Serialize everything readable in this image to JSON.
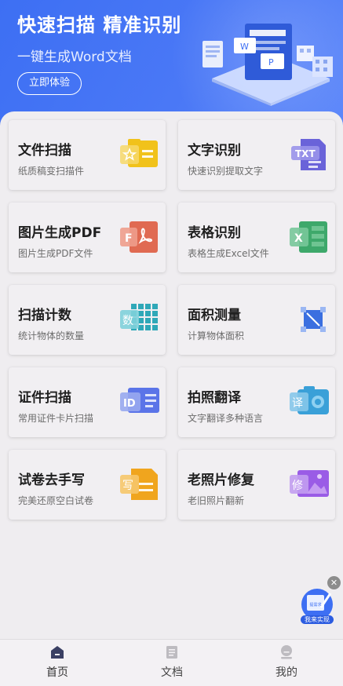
{
  "banner": {
    "title": "快速扫描 精准识别",
    "subtitle": "一键生成Word文档",
    "cta_label": "立即体验"
  },
  "features": [
    {
      "title": "文件扫描",
      "subtitle": "纸质稿变扫描件",
      "icon": "folder-star-icon",
      "color": "#f1c21b"
    },
    {
      "title": "文字识别",
      "subtitle": "快速识别提取文字",
      "icon": "txt-document-icon",
      "color": "#6a63d9"
    },
    {
      "title": "图片生成PDF",
      "subtitle": "图片生成PDF文件",
      "icon": "pdf-document-icon",
      "color": "#e06a52"
    },
    {
      "title": "表格识别",
      "subtitle": "表格生成Excel文件",
      "icon": "excel-document-icon",
      "color": "#3ea86b"
    },
    {
      "title": "扫描计数",
      "subtitle": "统计物体的数量",
      "icon": "count-grid-icon",
      "color": "#2fa8b8"
    },
    {
      "title": "面积测量",
      "subtitle": "计算物体面积",
      "icon": "area-measure-icon",
      "color": "#3b6fe0"
    },
    {
      "title": "证件扫描",
      "subtitle": "常用证件卡片扫描",
      "icon": "id-card-icon",
      "color": "#5b74e8"
    },
    {
      "title": "拍照翻译",
      "subtitle": "文字翻译多种语言",
      "icon": "camera-translate-icon",
      "color": "#3aa0d8"
    },
    {
      "title": "试卷去手写",
      "subtitle": "完美还原空白试卷",
      "icon": "exam-paper-icon",
      "color": "#f0a51e"
    },
    {
      "title": "老照片修复",
      "subtitle": "老旧照片翻新",
      "icon": "photo-restore-icon",
      "color": "#9a5ce6"
    }
  ],
  "float_ad": {
    "top_text": "提需求",
    "label": "我来实现"
  },
  "tabs": [
    {
      "label": "首页",
      "icon": "home-icon",
      "active": true
    },
    {
      "label": "文档",
      "icon": "document-icon",
      "active": false
    },
    {
      "label": "我的",
      "icon": "profile-icon",
      "active": false
    }
  ]
}
